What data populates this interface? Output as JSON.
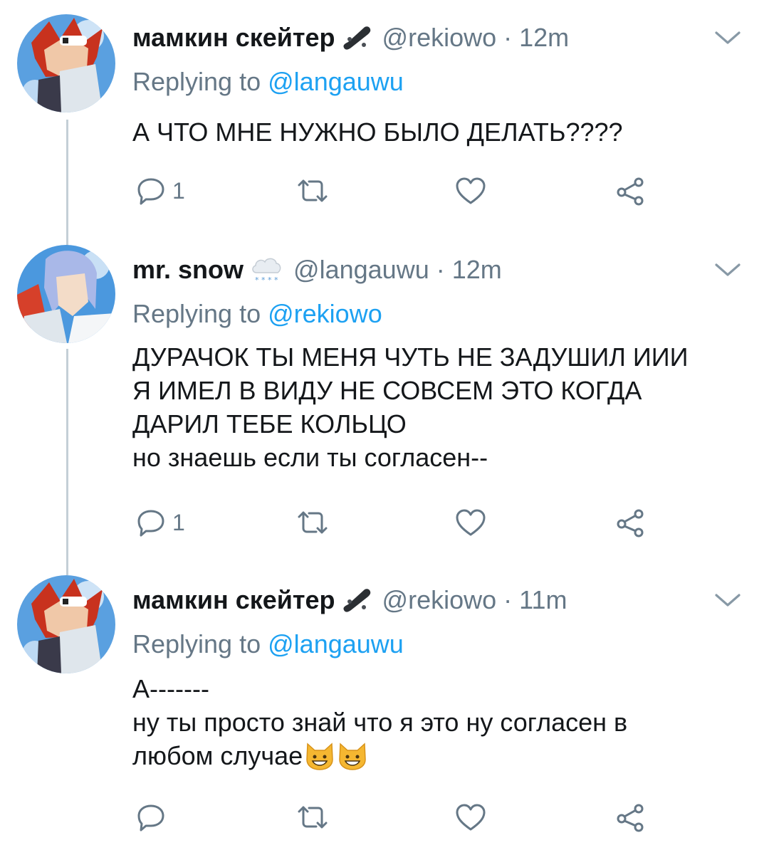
{
  "tweets": [
    {
      "name": "мамкин скейтер",
      "name_emoji": "skateboard-icon",
      "handle": "@rekiowo",
      "separator": "·",
      "time": "12m",
      "replying_label": "Replying to",
      "replying_to": "@langauwu",
      "lines": [
        "А ЧТО МНЕ НУЖНО БЫЛО ДЕЛАТЬ????"
      ],
      "reply_count": "1"
    },
    {
      "name": "mr. snow",
      "name_emoji": "snow-cloud-icon",
      "handle": "@langauwu",
      "separator": "·",
      "time": "12m",
      "replying_label": "Replying to",
      "replying_to": "@rekiowo",
      "lines": [
        "ДУРАЧОК ТЫ МЕНЯ ЧУТЬ НЕ ЗАДУШИЛ ИИИ",
        "Я ИМЕЛ В ВИДУ НЕ СОВСЕМ ЭТО КОГДА",
        "ДАРИЛ ТЕБЕ КОЛЬЦО",
        "но знаешь если ты согласен--"
      ],
      "reply_count": "1"
    },
    {
      "name": "мамкин скейтер",
      "name_emoji": "skateboard-icon",
      "handle": "@rekiowo",
      "separator": "·",
      "time": "11m",
      "replying_label": "Replying to",
      "replying_to": "@langauwu",
      "lines": [
        "А-------",
        "ну ты просто знай что я это ну согласен в",
        "любом случае"
      ],
      "trailing_emoji": [
        "grinning-cat-icon",
        "grinning-cat-icon"
      ],
      "reply_count": ""
    }
  ],
  "colors": {
    "text": "#14171a",
    "secondary": "#657786",
    "accent": "#1da1f2",
    "thread_line": "#c4cfd6"
  }
}
